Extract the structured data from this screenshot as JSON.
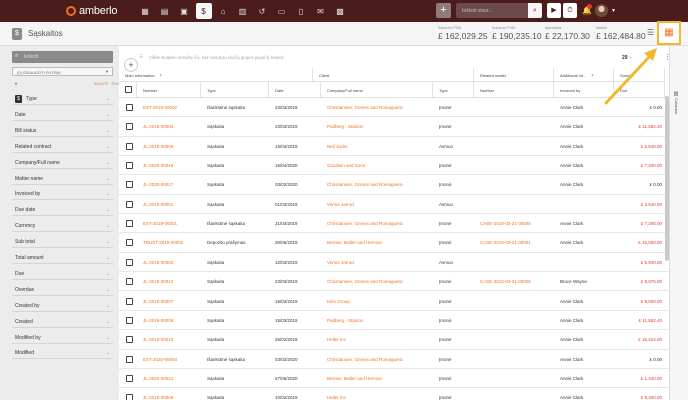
{
  "app": {
    "brand": "amberlo"
  },
  "topbar": {
    "nav_icons": [
      "dashboard-icon",
      "apps-icon",
      "briefcase-icon",
      "invoice-icon",
      "bank-icon",
      "calendar-icon",
      "history-icon",
      "folder-icon",
      "document-icon",
      "mail-icon",
      "reports-icon"
    ],
    "search_placeholder": "Ieškoti visur...",
    "add": "+",
    "play": "▶",
    "timer": "⏱"
  },
  "header": {
    "title": "Sąskaitos",
    "stats": [
      {
        "label": "Suma be PVM",
        "value": "£ 162,029.25"
      },
      {
        "label": "Suma su PVM",
        "value": "£ 190,235.10"
      },
      {
        "label": "Apmokėta",
        "value": "£ 22,170.30"
      },
      {
        "label": "Mokėti",
        "value": "£ 162,484.80"
      }
    ]
  },
  "sidebar": {
    "search_placeholder": "Ieškoti",
    "saved_select": "(0) IŠSAUGOTI FILTRAI",
    "saved_a": "SAUGOTI",
    "saved_b": "IŠVALYTI",
    "filters": [
      "Type",
      "Date",
      "Bill status",
      "Related contract",
      "Company/Full name",
      "Matter name",
      "Invoiced by",
      "Due date",
      "Currency",
      "Sub total",
      "Total amount",
      "Due",
      "Overdue",
      "Created by",
      "Created",
      "Modified by",
      "Modified"
    ]
  },
  "table": {
    "group_hint": "Vilkite stulpelio antraštę čia, kad nustatytų eilučių grupes pagal šį stulpelį",
    "count": "29",
    "count_suffix": "›",
    "group_headers": [
      "Main information",
      "Client",
      "Related matter",
      "Additional inf...",
      "Summ..."
    ],
    "columns": [
      "Number",
      "Type",
      "Date",
      "Company/Full name",
      "Type",
      "Number",
      "Invoiced by",
      "Due"
    ],
    "rows": [
      {
        "number": "EST-2019-00002",
        "type": "Išankstinė sąskaita",
        "date": "23/03/2019",
        "company": "Christiansen, Grimes and Romaguera",
        "ctype": "Įmonė",
        "matter": "",
        "invoiced": "Annie Clark",
        "due": "£ 0.00",
        "red": false
      },
      {
        "number": "JL-2019-00004",
        "type": "Sąskaita",
        "date": "23/03/2019",
        "company": "Padberg - Stanton",
        "ctype": "Įmonė",
        "matter": "",
        "invoiced": "Annie Clark",
        "due": "£ 11,582.40",
        "red": true
      },
      {
        "number": "JL-2019-00006",
        "type": "Sąskaita",
        "date": "15/03/2019",
        "company": "Neil Jacks",
        "ctype": "Asmuo",
        "matter": "",
        "invoiced": "Annie Clark",
        "due": "£ 5,640.00",
        "red": true
      },
      {
        "number": "JL-2020-00019",
        "type": "Sąskaita",
        "date": "16/04/2020",
        "company": "Goodwin and Sons",
        "ctype": "Įmonė",
        "matter": "",
        "invoiced": "Annie Clark",
        "due": "£ 7,200.00",
        "red": true
      },
      {
        "number": "JL-2020-00017",
        "type": "Sąskaita",
        "date": "03/02/2020",
        "company": "Christiansen, Grimes and Romaguera",
        "ctype": "Įmonė",
        "matter": "",
        "invoiced": "Annie Clark",
        "due": "£ 0.00",
        "red": false
      },
      {
        "number": "JL-2019-00001",
        "type": "Sąskaita",
        "date": "01/03/2019",
        "company": "Vernie Jarrod",
        "ctype": "Asmuo",
        "matter": "",
        "invoiced": "",
        "due": "£ 3,540.00",
        "red": true
      },
      {
        "number": "EST-2019-00001",
        "type": "Išankstinė sąskaita",
        "date": "21/03/2019",
        "company": "Christiansen, Grimes and Romaguera",
        "ctype": "Įmonė",
        "matter": "CASE-2019-03-21-00008",
        "invoiced": "Annie Clark",
        "due": "£ 7,200.00",
        "red": true
      },
      {
        "number": "TRUST-2019-00002",
        "type": "Depozito prašymas",
        "date": "30/05/2019",
        "company": "Bernier, Muller and Herman",
        "ctype": "Įmonė",
        "matter": "CASE-2019-03-21-00001",
        "invoiced": "Annie Clark",
        "due": "£ 15,000.00",
        "red": true
      },
      {
        "number": "JL-2019-00002",
        "type": "Sąskaita",
        "date": "12/03/2019",
        "company": "Vernie Jarrod",
        "ctype": "Asmuo",
        "matter": "",
        "invoiced": "",
        "due": "£ 5,940.00",
        "red": true
      },
      {
        "number": "JL-2019-00012",
        "type": "Sąskaita",
        "date": "23/03/2019",
        "company": "Christiansen, Grimes and Romaguera",
        "ctype": "Įmonė",
        "matter": "CASE-2019-03-21-00008",
        "invoiced": "Bruce Wayne",
        "due": "£ 8,976.00",
        "red": true
      },
      {
        "number": "JL-2019-00007",
        "type": "Sąskaita",
        "date": "15/03/2019",
        "company": "Kihn Group",
        "ctype": "Įmonė",
        "matter": "",
        "invoiced": "Annie Clark",
        "due": "£ 9,600.00",
        "red": true
      },
      {
        "number": "JL-2019-00005",
        "type": "Sąskaita",
        "date": "15/03/2019",
        "company": "Padberg - Stanton",
        "ctype": "Įmonė",
        "matter": "",
        "invoiced": "Annie Clark",
        "due": "£ 11,582.40",
        "red": true
      },
      {
        "number": "JL-2019-00010",
        "type": "Sąskaita",
        "date": "26/02/2019",
        "company": "Heller Inc",
        "ctype": "Įmonė",
        "matter": "",
        "invoiced": "Annie Clark",
        "due": "£ 16,224.00",
        "red": true
      },
      {
        "number": "EST-2020-00004",
        "type": "Išankstinė sąskaita",
        "date": "03/02/2020",
        "company": "Christiansen, Grimes and Romaguera",
        "ctype": "Įmonė",
        "matter": "",
        "invoiced": "Annie Clark",
        "due": "£ 0.00",
        "red": false
      },
      {
        "number": "JL-2020-00021",
        "type": "Sąskaita",
        "date": "27/05/2020",
        "company": "Bernier, Muller and Herman",
        "ctype": "Įmonė",
        "matter": "",
        "invoiced": "Annie Clark",
        "due": "£ 1,440.00",
        "red": true
      },
      {
        "number": "JL-2019-00009",
        "type": "Sąskaita",
        "date": "10/02/2019",
        "company": "Heller Inc",
        "ctype": "Įmonė",
        "matter": "",
        "invoiced": "Annie Clark",
        "due": "£ 8,400.00",
        "red": true
      }
    ]
  },
  "rightbar": {
    "columns_label": "Columns"
  },
  "colors": {
    "topbar": "#4a1c1c",
    "accent": "#f36f21",
    "highlight": "#f0b72f",
    "danger": "#e53935"
  }
}
